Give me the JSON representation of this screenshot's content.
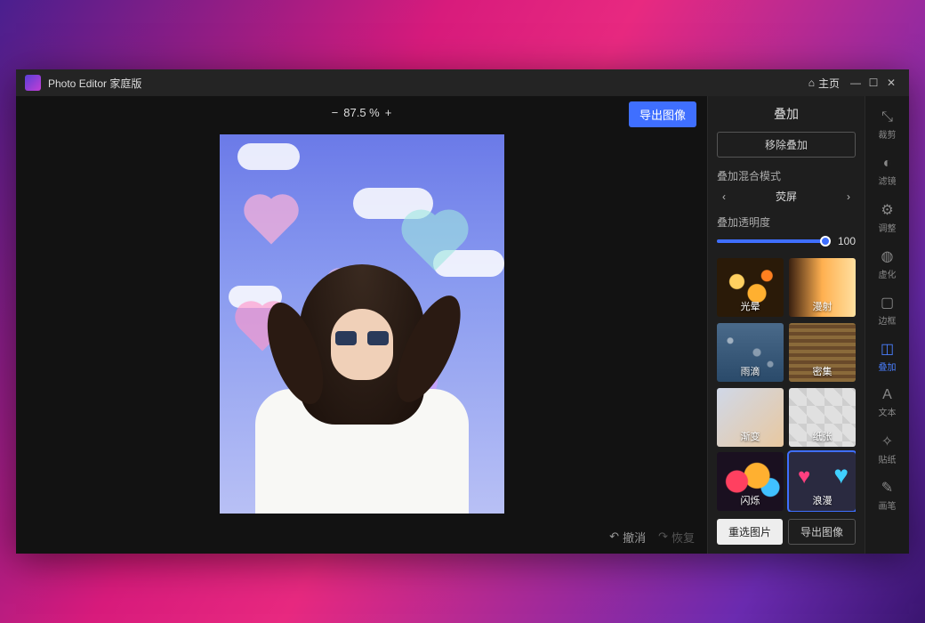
{
  "titlebar": {
    "app_title": "Photo Editor 家庭版",
    "home_label": "主页"
  },
  "canvas": {
    "zoom_text": "87.5 %",
    "export_label": "导出图像",
    "undo_label": "撤消",
    "redo_label": "恢复"
  },
  "panel": {
    "title": "叠加",
    "remove_label": "移除叠加",
    "blend_label": "叠加混合模式",
    "blend_value": "荧屏",
    "opacity_label": "叠加透明度",
    "opacity_value": "100",
    "overlays": [
      {
        "label": "光晕",
        "cls": "ov-bokeh"
      },
      {
        "label": "漫射",
        "cls": "ov-scatter"
      },
      {
        "label": "雨滴",
        "cls": "ov-rain"
      },
      {
        "label": "密集",
        "cls": "ov-dense"
      },
      {
        "label": "渐变",
        "cls": "ov-gradient"
      },
      {
        "label": "纸张",
        "cls": "ov-paper"
      },
      {
        "label": "闪烁",
        "cls": "ov-flash"
      },
      {
        "label": "浪漫",
        "cls": "ov-romance",
        "selected": true
      }
    ],
    "reselect_label": "重选图片",
    "export2_label": "导出图像"
  },
  "rail": {
    "items": [
      {
        "label": "裁剪",
        "icon": "⤡"
      },
      {
        "label": "滤镜",
        "icon": "◐"
      },
      {
        "label": "调整",
        "icon": "⚙"
      },
      {
        "label": "虚化",
        "icon": "◍"
      },
      {
        "label": "边框",
        "icon": "▢"
      },
      {
        "label": "叠加",
        "icon": "◫",
        "active": true
      },
      {
        "label": "文本",
        "icon": "A"
      },
      {
        "label": "贴纸",
        "icon": "✧"
      },
      {
        "label": "画笔",
        "icon": "✎"
      }
    ]
  }
}
